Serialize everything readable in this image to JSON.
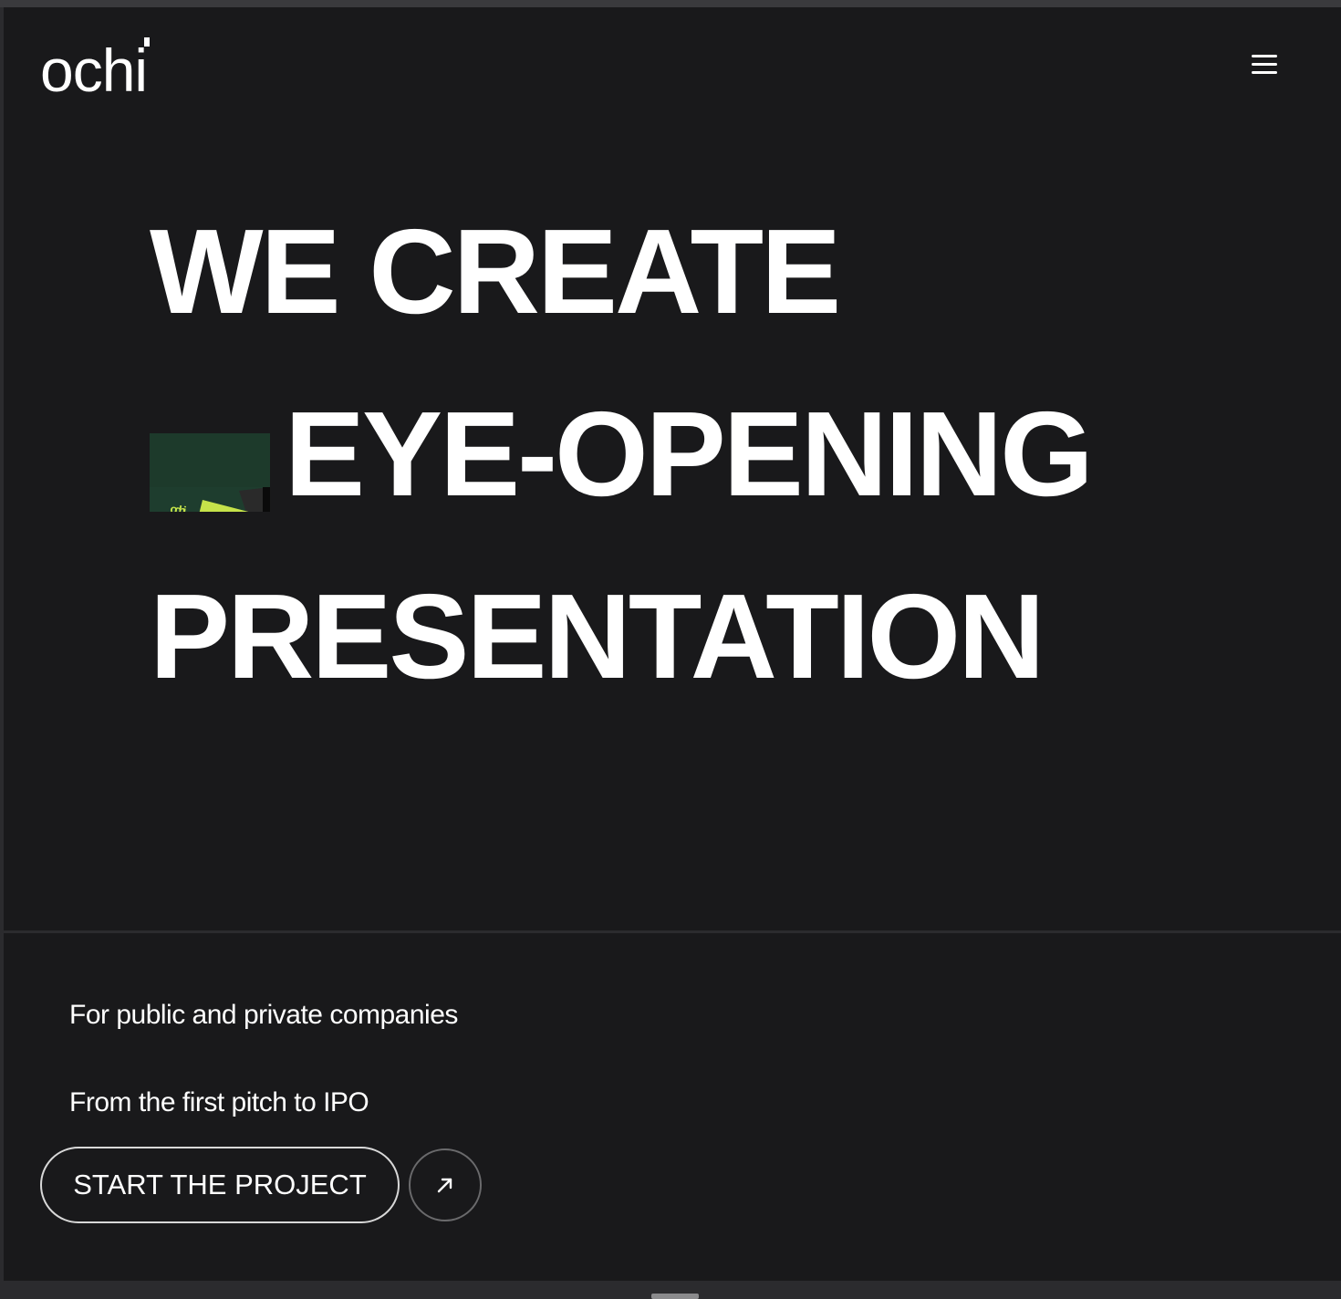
{
  "header": {
    "logo_text": "ochi",
    "menu_icon": "hamburger-menu-icon"
  },
  "hero": {
    "line1": "WE CREATE",
    "line2": "EYE-OPENING",
    "line3": "PRESENTATION",
    "thumbnail": {
      "label_top": "ochi",
      "label_bottom": "ochi"
    }
  },
  "bottom": {
    "tagline1": "For public and private companies",
    "tagline2": "From the first pitch to IPO",
    "cta_label": "START THE PROJECT",
    "cta_icon": "arrow-up-right-icon"
  },
  "colors": {
    "background": "#19191b",
    "text": "#ffffff",
    "accent_green": "#c5e34a",
    "accent_orange": "#c8643a"
  }
}
